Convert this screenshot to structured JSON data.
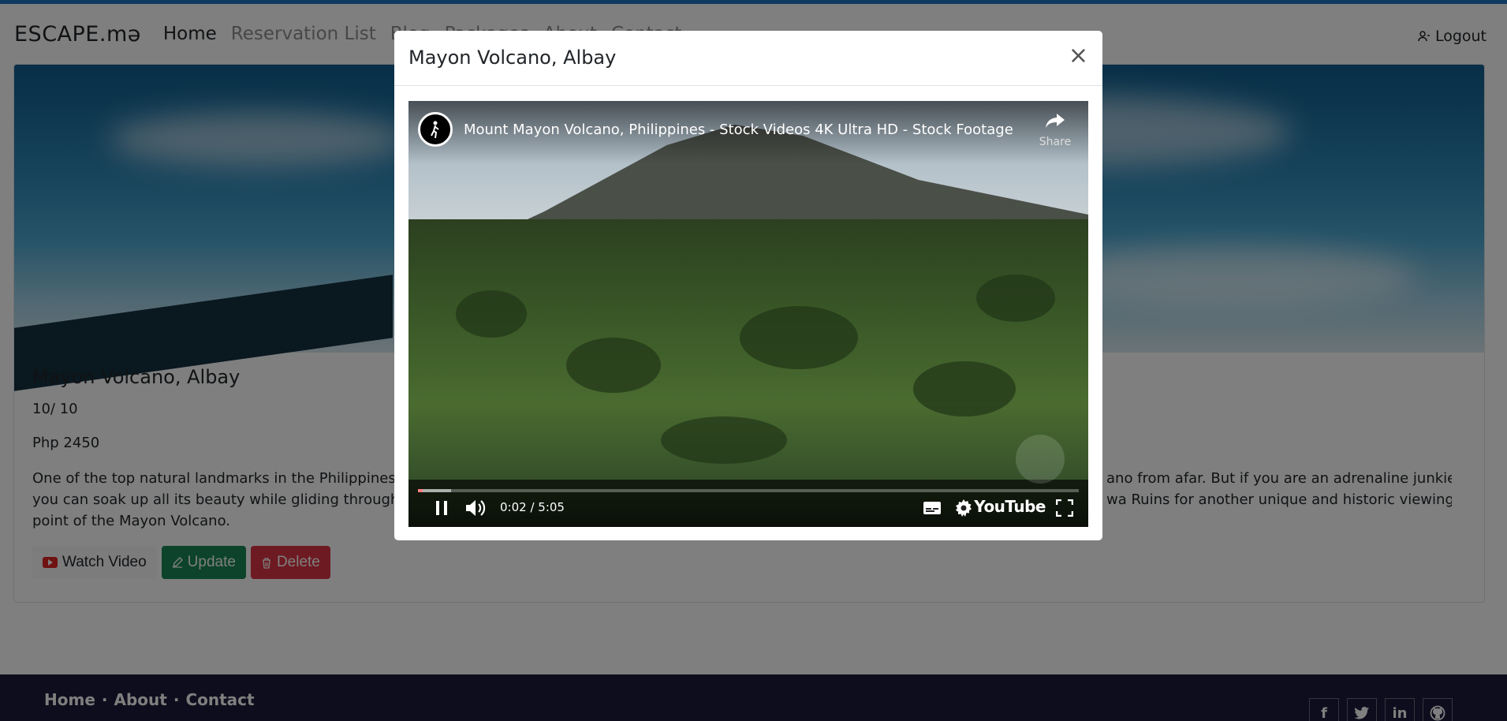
{
  "navbar": {
    "brand": "ESCAPE.mə",
    "links": [
      "Home",
      "Reservation List",
      "Blog",
      "Packages",
      "About",
      "Contact"
    ],
    "logout_label": "Logout"
  },
  "card": {
    "title": "Mayon Volcano, Albay",
    "rating": "10/ 10",
    "price": "Php 2450",
    "description_parts": [
      "One of the top natural landmarks in the Philippines c",
      "ano from afar. But if you are an adrenaline junkie,",
      "you can soak up all its beauty while gliding through",
      "wa Ruins for another unique and historic viewing",
      "point of the Mayon Volcano."
    ],
    "buttons": {
      "watch": "Watch Video",
      "update": "Update",
      "delete": "Delete"
    }
  },
  "modal": {
    "title": "Mayon Volcano, Albay",
    "close_symbol": "×",
    "video": {
      "title": "Mount Mayon Volcano, Philippines - Stock Videos 4K Ultra HD - Stock Footage",
      "share_label": "Share",
      "time": "0:02 / 5:05",
      "progress": 0.007,
      "wordmark": "YouTube"
    }
  },
  "footer": {
    "links": [
      "Home",
      "About",
      "Contact"
    ],
    "separator": "·",
    "social": [
      "f",
      "in"
    ]
  },
  "colors": {
    "accent": "#1e73be",
    "success": "#198754",
    "danger": "#dc3545",
    "footer": "#1c1b3a"
  }
}
